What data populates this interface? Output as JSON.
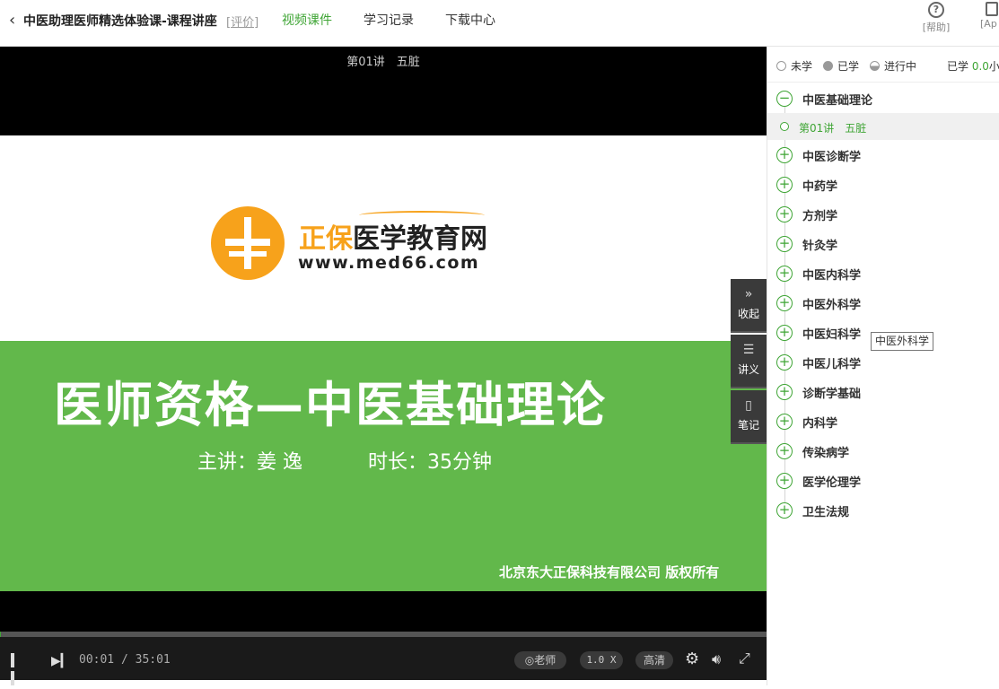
{
  "header": {
    "back_icon": "chevron-left-icon",
    "course_title": "中医助理医师精选体验课-课程讲座",
    "rate_label": "[评价]",
    "tabs": [
      {
        "label": "视频课件",
        "active": true
      },
      {
        "label": "学习记录",
        "active": false
      },
      {
        "label": "下载中心",
        "active": false
      }
    ],
    "help_label": "[帮助]",
    "app_label": "[Ap"
  },
  "player": {
    "lecture_title": "第01讲　五脏",
    "slide": {
      "brand_part1": "正保",
      "brand_part2": "医学教育网",
      "brand_url": "www.med66.com",
      "heading": "医师资格—中医基础理论",
      "presenter": "主讲：姜  逸",
      "duration": "时长：35分钟",
      "copyright": "北京东大正保科技有限公司  版权所有"
    },
    "controls": {
      "current_time": "00:01",
      "total_time": "35:01",
      "time_separator": " / ",
      "progress_fraction": 0.0005,
      "teacher_label": "老师",
      "speed_label": "1.0 X",
      "quality_label": "高清"
    },
    "side_tabs": [
      {
        "icon": "double-chevron-right-icon",
        "glyph": "»",
        "label": "收起"
      },
      {
        "icon": "list-icon",
        "glyph": "☰",
        "label": "讲义"
      },
      {
        "icon": "notebook-icon",
        "glyph": "▯",
        "label": "笔记"
      }
    ]
  },
  "panel": {
    "legend": {
      "not_learned": "未学",
      "learned": "已学",
      "in_progress": "进行中",
      "total_prefix": "已学 ",
      "total_value": "0.0",
      "total_suffix": "小时"
    },
    "chapters": [
      {
        "label": "中医基础理论",
        "expanded": true
      },
      {
        "label": "中医诊断学",
        "expanded": false
      },
      {
        "label": "中药学",
        "expanded": false
      },
      {
        "label": "方剂学",
        "expanded": false
      },
      {
        "label": "针灸学",
        "expanded": false
      },
      {
        "label": "中医内科学",
        "expanded": false
      },
      {
        "label": "中医外科学",
        "expanded": false
      },
      {
        "label": "中医妇科学",
        "expanded": false
      },
      {
        "label": "中医儿科学",
        "expanded": false
      },
      {
        "label": "诊断学基础",
        "expanded": false
      },
      {
        "label": "内科学",
        "expanded": false
      },
      {
        "label": "传染病学",
        "expanded": false
      },
      {
        "label": "医学伦理学",
        "expanded": false
      },
      {
        "label": "卫生法规",
        "expanded": false
      }
    ],
    "current_lesson": "第01讲　五脏",
    "tooltip": "中医外科学"
  },
  "colors": {
    "accent": "#3fa535",
    "slide_green": "#62b84b",
    "brand_orange": "#f7a21b"
  }
}
